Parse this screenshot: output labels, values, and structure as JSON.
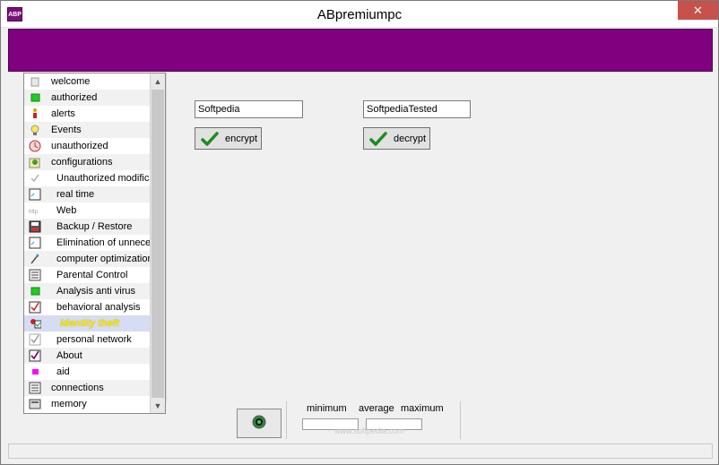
{
  "window": {
    "title": "ABpremiumpc",
    "app_icon_text": "ABP",
    "close_glyph": "✕"
  },
  "colors": {
    "banner": "#800080",
    "selected_row": "#d6dcf4",
    "selected_text": "#f5e600",
    "close_button": "#c7514b",
    "check_green": "#1e8c1e"
  },
  "sidebar": {
    "items": [
      {
        "label": "welcome",
        "icon": "document-icon",
        "sub": false
      },
      {
        "label": "authorized",
        "icon": "green-square-icon",
        "sub": false
      },
      {
        "label": "alerts",
        "icon": "alert-figure-icon",
        "sub": false
      },
      {
        "label": "Events",
        "icon": "lightbulb-icon",
        "sub": false
      },
      {
        "label": "unauthorized",
        "icon": "clock-icon",
        "sub": false
      },
      {
        "label": "configurations",
        "icon": "config-gear-icon",
        "sub": false
      },
      {
        "label": "Unauthorized modifica",
        "icon": "small-check-icon",
        "sub": true
      },
      {
        "label": "real time",
        "icon": "grid-icon",
        "sub": true
      },
      {
        "label": "Web",
        "icon": "http-icon",
        "sub": true
      },
      {
        "label": "Backup / Restore",
        "icon": "floppy-icon",
        "sub": true
      },
      {
        "label": "Elimination of unneces",
        "icon": "grid-icon",
        "sub": true
      },
      {
        "label": "computer optimization",
        "icon": "wand-icon",
        "sub": true
      },
      {
        "label": "Parental Control",
        "icon": "list-icon",
        "sub": true
      },
      {
        "label": "Analysis anti virus",
        "icon": "green-square-icon",
        "sub": true
      },
      {
        "label": "behavioral analysis",
        "icon": "red-check-icon",
        "sub": true
      },
      {
        "label": "identity theft",
        "icon": "identity-icon",
        "sub": true,
        "selected": true
      },
      {
        "label": "personal network",
        "icon": "gray-check-icon",
        "sub": true
      },
      {
        "label": "About",
        "icon": "purple-check-icon",
        "sub": true
      },
      {
        "label": "aid",
        "icon": "magenta-square-icon",
        "sub": true
      },
      {
        "label": "connections",
        "icon": "list-icon",
        "sub": false
      },
      {
        "label": "memory",
        "icon": "memory-icon",
        "sub": false
      }
    ]
  },
  "main": {
    "encrypt_input_value": "Softpedia",
    "decrypt_input_value": "SoftpediaTested",
    "encrypt_label": "encrypt",
    "decrypt_label": "decrypt"
  },
  "bottom": {
    "minimum_label": "minimum",
    "average_label": "average",
    "maximum_label": "maximum"
  },
  "watermark": "www.softpedia.com"
}
